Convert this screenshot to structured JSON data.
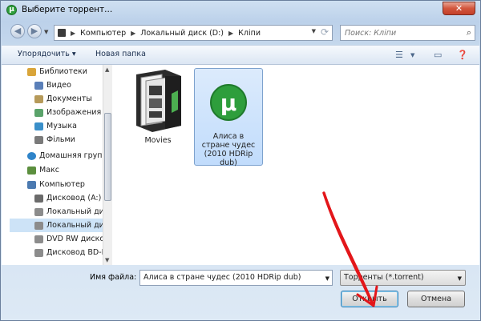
{
  "window": {
    "title": "Выберите торрент...",
    "close_label": "✕"
  },
  "nav": {
    "back_label": "◀",
    "forward_label": "▶",
    "breadcrumb": [
      "Компьютер",
      "Локальный диск (D:)",
      "Кліпи"
    ],
    "search_placeholder": "Поиск: Кліпи"
  },
  "toolbar": {
    "organize_label": "Упорядочить ▾",
    "new_folder_label": "Новая папка"
  },
  "sidebar": {
    "items": [
      {
        "label": "Библиотеки",
        "icon": "library-icon",
        "color": "#d9a53a"
      },
      {
        "label": "Видео",
        "icon": "video-icon",
        "color": "#5a7fb8"
      },
      {
        "label": "Документы",
        "icon": "documents-icon",
        "color": "#b69a5a"
      },
      {
        "label": "Изображения",
        "icon": "images-icon",
        "color": "#5aa36a"
      },
      {
        "label": "Музыка",
        "icon": "music-icon",
        "color": "#3a8fc9"
      },
      {
        "label": "Фільми",
        "icon": "films-icon",
        "color": "#7a7a7a"
      },
      {
        "label": "Домашняя груп",
        "icon": "homegroup-icon",
        "color": "#2f84c9"
      },
      {
        "label": "Макс",
        "icon": "user-icon",
        "color": "#5c8f3e"
      },
      {
        "label": "Компьютер",
        "icon": "computer-icon",
        "color": "#4c7ab0"
      },
      {
        "label": "Дисковод (A:)",
        "icon": "floppy-icon",
        "color": "#6b6b6b"
      },
      {
        "label": "Локальный ди",
        "icon": "hard-disk-icon",
        "color": "#8c8c8c"
      },
      {
        "label": "Локальный ди",
        "icon": "hard-disk-icon",
        "color": "#8c8c8c"
      },
      {
        "label": "DVD RW диско",
        "icon": "dvd-icon",
        "color": "#8c8c8c"
      },
      {
        "label": "Дисковод BD-R",
        "icon": "bd-icon",
        "color": "#8c8c8c"
      }
    ]
  },
  "files": [
    {
      "name": "Movies",
      "icon": "folder-icon"
    },
    {
      "name": "Алиса в стране чудес (2010 HDRip dub)",
      "icon": "utorrent-icon"
    }
  ],
  "footer": {
    "filename_label": "Имя файла:",
    "filename_value": "Алиса в стране чудес (2010 HDRip dub)",
    "filter_value": "Торренты (*.torrent)",
    "open_label": "Открыть",
    "cancel_label": "Отмена"
  },
  "colors": {
    "accent_green": "#2e9e3c",
    "annotation_red": "#e3161a",
    "selection": "#c1dcfc"
  }
}
